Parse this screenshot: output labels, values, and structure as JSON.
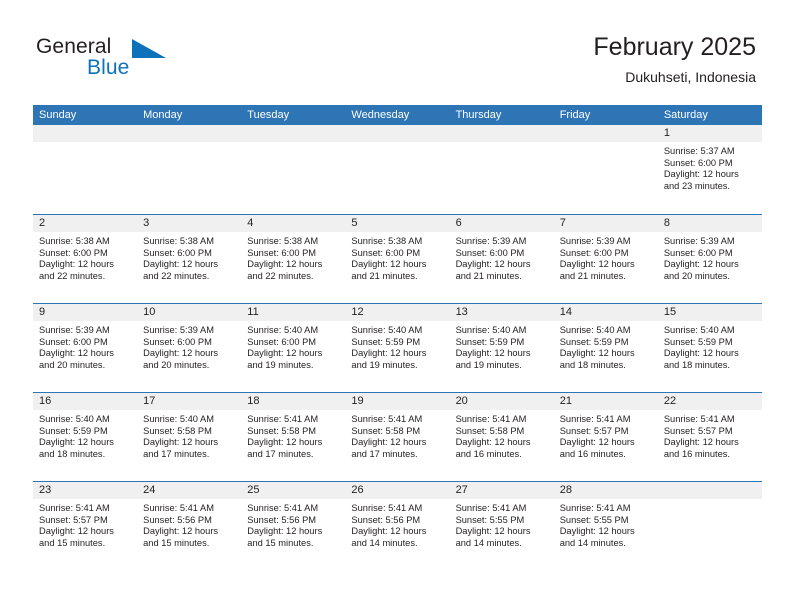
{
  "brand": {
    "word1": "General",
    "word2": "Blue",
    "flag_icon": "triangle-flag-icon"
  },
  "header": {
    "title": "February 2025",
    "subtitle": "Dukuhseti, Indonesia"
  },
  "colors": {
    "header_blue": "#2e75b6",
    "brand_blue": "#0e72bb",
    "date_band": "#f0f0f0",
    "text": "#231f20"
  },
  "weekdays": [
    "Sunday",
    "Monday",
    "Tuesday",
    "Wednesday",
    "Thursday",
    "Friday",
    "Saturday"
  ],
  "weeks": [
    [
      {
        "date": ""
      },
      {
        "date": ""
      },
      {
        "date": ""
      },
      {
        "date": ""
      },
      {
        "date": ""
      },
      {
        "date": ""
      },
      {
        "date": "1",
        "sunrise": "Sunrise: 5:37 AM",
        "sunset": "Sunset: 6:00 PM",
        "daylight": "Daylight: 12 hours and 23 minutes."
      }
    ],
    [
      {
        "date": "2",
        "sunrise": "Sunrise: 5:38 AM",
        "sunset": "Sunset: 6:00 PM",
        "daylight": "Daylight: 12 hours and 22 minutes."
      },
      {
        "date": "3",
        "sunrise": "Sunrise: 5:38 AM",
        "sunset": "Sunset: 6:00 PM",
        "daylight": "Daylight: 12 hours and 22 minutes."
      },
      {
        "date": "4",
        "sunrise": "Sunrise: 5:38 AM",
        "sunset": "Sunset: 6:00 PM",
        "daylight": "Daylight: 12 hours and 22 minutes."
      },
      {
        "date": "5",
        "sunrise": "Sunrise: 5:38 AM",
        "sunset": "Sunset: 6:00 PM",
        "daylight": "Daylight: 12 hours and 21 minutes."
      },
      {
        "date": "6",
        "sunrise": "Sunrise: 5:39 AM",
        "sunset": "Sunset: 6:00 PM",
        "daylight": "Daylight: 12 hours and 21 minutes."
      },
      {
        "date": "7",
        "sunrise": "Sunrise: 5:39 AM",
        "sunset": "Sunset: 6:00 PM",
        "daylight": "Daylight: 12 hours and 21 minutes."
      },
      {
        "date": "8",
        "sunrise": "Sunrise: 5:39 AM",
        "sunset": "Sunset: 6:00 PM",
        "daylight": "Daylight: 12 hours and 20 minutes."
      }
    ],
    [
      {
        "date": "9",
        "sunrise": "Sunrise: 5:39 AM",
        "sunset": "Sunset: 6:00 PM",
        "daylight": "Daylight: 12 hours and 20 minutes."
      },
      {
        "date": "10",
        "sunrise": "Sunrise: 5:39 AM",
        "sunset": "Sunset: 6:00 PM",
        "daylight": "Daylight: 12 hours and 20 minutes."
      },
      {
        "date": "11",
        "sunrise": "Sunrise: 5:40 AM",
        "sunset": "Sunset: 6:00 PM",
        "daylight": "Daylight: 12 hours and 19 minutes."
      },
      {
        "date": "12",
        "sunrise": "Sunrise: 5:40 AM",
        "sunset": "Sunset: 5:59 PM",
        "daylight": "Daylight: 12 hours and 19 minutes."
      },
      {
        "date": "13",
        "sunrise": "Sunrise: 5:40 AM",
        "sunset": "Sunset: 5:59 PM",
        "daylight": "Daylight: 12 hours and 19 minutes."
      },
      {
        "date": "14",
        "sunrise": "Sunrise: 5:40 AM",
        "sunset": "Sunset: 5:59 PM",
        "daylight": "Daylight: 12 hours and 18 minutes."
      },
      {
        "date": "15",
        "sunrise": "Sunrise: 5:40 AM",
        "sunset": "Sunset: 5:59 PM",
        "daylight": "Daylight: 12 hours and 18 minutes."
      }
    ],
    [
      {
        "date": "16",
        "sunrise": "Sunrise: 5:40 AM",
        "sunset": "Sunset: 5:59 PM",
        "daylight": "Daylight: 12 hours and 18 minutes."
      },
      {
        "date": "17",
        "sunrise": "Sunrise: 5:40 AM",
        "sunset": "Sunset: 5:58 PM",
        "daylight": "Daylight: 12 hours and 17 minutes."
      },
      {
        "date": "18",
        "sunrise": "Sunrise: 5:41 AM",
        "sunset": "Sunset: 5:58 PM",
        "daylight": "Daylight: 12 hours and 17 minutes."
      },
      {
        "date": "19",
        "sunrise": "Sunrise: 5:41 AM",
        "sunset": "Sunset: 5:58 PM",
        "daylight": "Daylight: 12 hours and 17 minutes."
      },
      {
        "date": "20",
        "sunrise": "Sunrise: 5:41 AM",
        "sunset": "Sunset: 5:58 PM",
        "daylight": "Daylight: 12 hours and 16 minutes."
      },
      {
        "date": "21",
        "sunrise": "Sunrise: 5:41 AM",
        "sunset": "Sunset: 5:57 PM",
        "daylight": "Daylight: 12 hours and 16 minutes."
      },
      {
        "date": "22",
        "sunrise": "Sunrise: 5:41 AM",
        "sunset": "Sunset: 5:57 PM",
        "daylight": "Daylight: 12 hours and 16 minutes."
      }
    ],
    [
      {
        "date": "23",
        "sunrise": "Sunrise: 5:41 AM",
        "sunset": "Sunset: 5:57 PM",
        "daylight": "Daylight: 12 hours and 15 minutes."
      },
      {
        "date": "24",
        "sunrise": "Sunrise: 5:41 AM",
        "sunset": "Sunset: 5:56 PM",
        "daylight": "Daylight: 12 hours and 15 minutes."
      },
      {
        "date": "25",
        "sunrise": "Sunrise: 5:41 AM",
        "sunset": "Sunset: 5:56 PM",
        "daylight": "Daylight: 12 hours and 15 minutes."
      },
      {
        "date": "26",
        "sunrise": "Sunrise: 5:41 AM",
        "sunset": "Sunset: 5:56 PM",
        "daylight": "Daylight: 12 hours and 14 minutes."
      },
      {
        "date": "27",
        "sunrise": "Sunrise: 5:41 AM",
        "sunset": "Sunset: 5:55 PM",
        "daylight": "Daylight: 12 hours and 14 minutes."
      },
      {
        "date": "28",
        "sunrise": "Sunrise: 5:41 AM",
        "sunset": "Sunset: 5:55 PM",
        "daylight": "Daylight: 12 hours and 14 minutes."
      },
      {
        "date": ""
      }
    ]
  ]
}
